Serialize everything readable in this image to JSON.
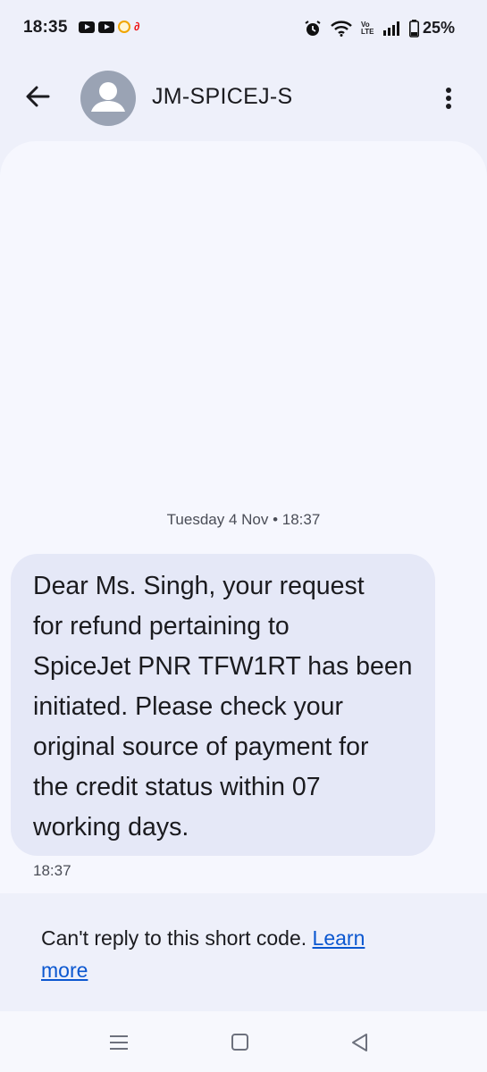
{
  "status_bar": {
    "time": "18:35",
    "battery": "25%",
    "left_icons": [
      "youtube-icon",
      "youtube-icon",
      "notification-icon",
      "airtel-icon"
    ],
    "right_icons": [
      "alarm-icon",
      "wifi-icon",
      "volte-icon",
      "signal-icon",
      "battery-icon"
    ],
    "volte_label": "Vo LTE"
  },
  "header": {
    "title": "JM-SPICEJ-S",
    "back_icon": "arrow-back-icon",
    "avatar_icon": "person-icon",
    "menu_icon": "more-vert-icon"
  },
  "conversation": {
    "timestamp": "Tuesday 4 Nov • 18:37",
    "message_lines": [
      "Dear Ms. Singh, your request",
      "for refund pertaining to",
      "SpiceJet PNR TFW1RT has been",
      "initiated. Please check your",
      "original source of payment for",
      "the credit status within 07",
      "working days."
    ],
    "message_time": "18:37"
  },
  "footer": {
    "notice": "Can't reply to this short code. ",
    "link_word1": "Learn",
    "link_word2": "more"
  },
  "colors": {
    "background": "#eef0fa",
    "conversation_bg": "#f6f7fe",
    "bubble": "#e5e8f7",
    "link": "#0b57d0"
  }
}
